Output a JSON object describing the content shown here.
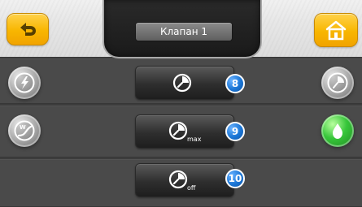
{
  "header": {
    "title": "Клапан 1",
    "back_icon": "back-arrow-icon",
    "home_icon": "home-icon"
  },
  "modes": [
    {
      "name": "mode-auto-button",
      "icon": "clock-icon",
      "sub": "",
      "badge": "8"
    },
    {
      "name": "mode-max-button",
      "icon": "clock-max-icon",
      "sub": "max",
      "badge": "9"
    },
    {
      "name": "mode-off-button",
      "icon": "clock-off-icon",
      "sub": "off",
      "badge": "10"
    }
  ],
  "left_icons": [
    "lightning-icon",
    "weather-curve-icon"
  ],
  "right_icons": [
    "clock-icon",
    "water-drop-icon"
  ],
  "colors": {
    "accent_yellow": "#f8b600",
    "badge_blue": "#1b76d6",
    "active_green": "#37c63a"
  }
}
